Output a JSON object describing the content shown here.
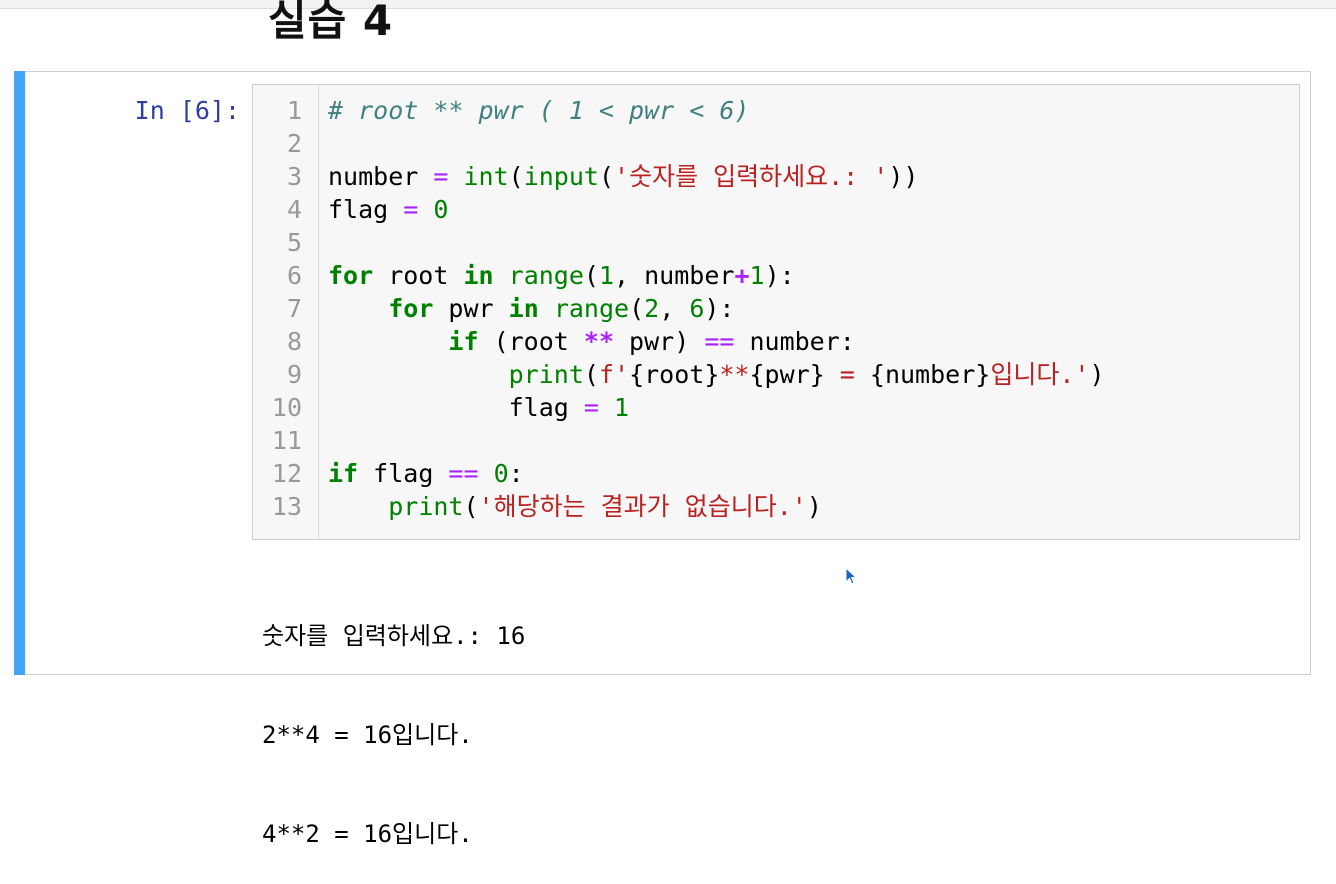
{
  "heading": "실습 4",
  "cell": {
    "prompt": "In [6]:",
    "line_numbers": [
      "1",
      "2",
      "3",
      "4",
      "5",
      "6",
      "7",
      "8",
      "9",
      "10",
      "11",
      "12",
      "13"
    ],
    "code": {
      "l1": "# root ** pwr ( 1 < pwr < 6)",
      "l3": {
        "var": "number",
        "eq": " = ",
        "int": "int",
        "p1": "(",
        "input": "input",
        "p2": "(",
        "str": "'숫자를 입력하세요.: '",
        "p3": "))"
      },
      "l4": {
        "var": "flag",
        "eq": " = ",
        "num": "0"
      },
      "l6": {
        "for": "for",
        "a": " root ",
        "in": "in",
        "sp": " ",
        "range": "range",
        "b": "(",
        "n1": "1",
        "c": ", number",
        "plus": "+",
        "n2": "1",
        "d": "):"
      },
      "l7": {
        "indent": "    ",
        "for": "for",
        "a": " pwr ",
        "in": "in",
        "sp": " ",
        "range": "range",
        "b": "(",
        "n1": "2",
        "c": ", ",
        "n2": "6",
        "d": "):"
      },
      "l8": {
        "indent": "        ",
        "if": "if",
        "a": " (root ",
        "pow": "**",
        "b": " pwr) ",
        "eqeq": "==",
        "c": " number:"
      },
      "l9": {
        "indent": "            ",
        "print": "print",
        "a": "(",
        "s1": "f'",
        "i1": "{root}",
        "s2": "**",
        "i2": "{pwr}",
        "s3": " = ",
        "i3": "{number}",
        "s4": "입니다.'",
        "b": ")"
      },
      "l10": {
        "indent": "            ",
        "var": "flag",
        "eq": " = ",
        "num": "1"
      },
      "l12": {
        "if": "if",
        "a": " flag ",
        "eqeq": "==",
        "sp": " ",
        "num": "0",
        "b": ":"
      },
      "l13": {
        "indent": "    ",
        "print": "print",
        "a": "(",
        "str": "'해당하는 결과가 없습니다.'",
        "b": ")"
      }
    },
    "output": [
      "숫자를 입력하세요.: 16",
      "2**4 = 16입니다.",
      "4**2 = 16입니다."
    ]
  },
  "colors": {
    "selected_cell_bar": "#42a5f5",
    "prompt": "#303f9f",
    "keyword": "#008000",
    "operator": "#aa22ff",
    "string": "#ba2121",
    "comment": "#408080"
  },
  "icons": {
    "cursor": "mouse-pointer-icon"
  }
}
